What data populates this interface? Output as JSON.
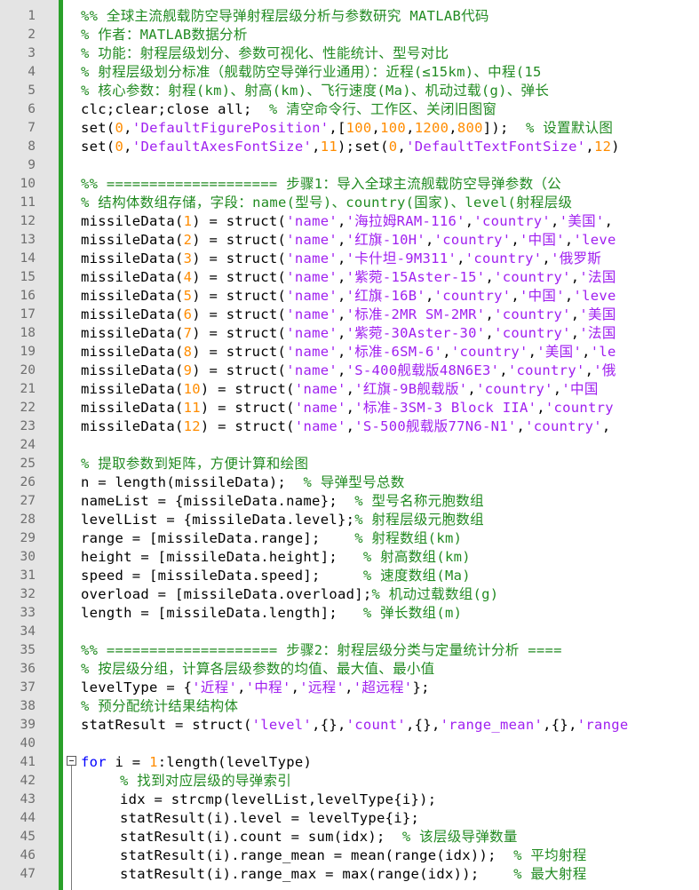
{
  "editor": {
    "colors": {
      "comment": "#228b22",
      "string": "#a020f0",
      "number": "#ff8c00",
      "keyword": "#0000ff",
      "gutter": "#e4e4e4",
      "fold_bar": "#2aa02a"
    },
    "lines": [
      {
        "n": "1",
        "tokens": [
          [
            "comment",
            "%% 全球主流舰载防空导弹射程层级分析与参数研究 MATLAB代码"
          ]
        ]
      },
      {
        "n": "2",
        "tokens": [
          [
            "comment",
            "% 作者：MATLAB数据分析"
          ]
        ]
      },
      {
        "n": "3",
        "tokens": [
          [
            "comment",
            "% 功能：射程层级划分、参数可视化、性能统计、型号对比"
          ]
        ]
      },
      {
        "n": "4",
        "tokens": [
          [
            "comment",
            "% 射程层级划分标准（舰载防空导弹行业通用）：近程(≤15km)、中程(15"
          ]
        ]
      },
      {
        "n": "5",
        "tokens": [
          [
            "comment",
            "% 核心参数：射程(km)、射高(km)、飞行速度(Ma)、机动过载(g)、弹长"
          ]
        ]
      },
      {
        "n": "6",
        "tokens": [
          [
            "text",
            "clc;clear;close all;  "
          ],
          [
            "comment",
            "% 清空命令行、工作区、关闭旧图窗"
          ]
        ]
      },
      {
        "n": "7",
        "tokens": [
          [
            "text",
            "set("
          ],
          [
            "number",
            "0"
          ],
          [
            "text",
            ","
          ],
          [
            "string",
            "'DefaultFigurePosition'"
          ],
          [
            "text",
            ",["
          ],
          [
            "number",
            "100"
          ],
          [
            "text",
            ","
          ],
          [
            "number",
            "100"
          ],
          [
            "text",
            ","
          ],
          [
            "number",
            "1200"
          ],
          [
            "text",
            ","
          ],
          [
            "number",
            "800"
          ],
          [
            "text",
            "]);  "
          ],
          [
            "comment",
            "% 设置默认图"
          ]
        ]
      },
      {
        "n": "8",
        "tokens": [
          [
            "text",
            "set("
          ],
          [
            "number",
            "0"
          ],
          [
            "text",
            ","
          ],
          [
            "string",
            "'DefaultAxesFontSize'"
          ],
          [
            "text",
            ","
          ],
          [
            "number",
            "11"
          ],
          [
            "text",
            ");set("
          ],
          [
            "number",
            "0"
          ],
          [
            "text",
            ","
          ],
          [
            "string",
            "'DefaultTextFontSize'"
          ],
          [
            "text",
            ","
          ],
          [
            "number",
            "12"
          ],
          [
            "text",
            ")"
          ]
        ]
      },
      {
        "n": "9",
        "tokens": []
      },
      {
        "n": "10",
        "tokens": [
          [
            "comment",
            "%% ==================== 步骤1：导入全球主流舰载防空导弹参数（公"
          ]
        ]
      },
      {
        "n": "11",
        "tokens": [
          [
            "comment",
            "% 结构体数组存储，字段：name(型号)、country(国家)、level(射程层级"
          ]
        ]
      },
      {
        "n": "12",
        "tokens": [
          [
            "text",
            "missileData("
          ],
          [
            "number",
            "1"
          ],
          [
            "text",
            ") = struct("
          ],
          [
            "string",
            "'name'"
          ],
          [
            "text",
            ","
          ],
          [
            "string",
            "'海拉姆RAM-116'"
          ],
          [
            "text",
            ","
          ],
          [
            "string",
            "'country'"
          ],
          [
            "text",
            ","
          ],
          [
            "string",
            "'美国'"
          ],
          [
            "text",
            ","
          ]
        ]
      },
      {
        "n": "13",
        "tokens": [
          [
            "text",
            "missileData("
          ],
          [
            "number",
            "2"
          ],
          [
            "text",
            ") = struct("
          ],
          [
            "string",
            "'name'"
          ],
          [
            "text",
            ","
          ],
          [
            "string",
            "'红旗-10H'"
          ],
          [
            "text",
            ","
          ],
          [
            "string",
            "'country'"
          ],
          [
            "text",
            ","
          ],
          [
            "string",
            "'中国'"
          ],
          [
            "text",
            ","
          ],
          [
            "string",
            "'leve"
          ]
        ]
      },
      {
        "n": "14",
        "tokens": [
          [
            "text",
            "missileData("
          ],
          [
            "number",
            "3"
          ],
          [
            "text",
            ") = struct("
          ],
          [
            "string",
            "'name'"
          ],
          [
            "text",
            ","
          ],
          [
            "string",
            "'卡什坦-9M311'"
          ],
          [
            "text",
            ","
          ],
          [
            "string",
            "'country'"
          ],
          [
            "text",
            ","
          ],
          [
            "string",
            "'俄罗斯"
          ]
        ]
      },
      {
        "n": "15",
        "tokens": [
          [
            "text",
            "missileData("
          ],
          [
            "number",
            "4"
          ],
          [
            "text",
            ") = struct("
          ],
          [
            "string",
            "'name'"
          ],
          [
            "text",
            ","
          ],
          [
            "string",
            "'紫菀-15Aster-15'"
          ],
          [
            "text",
            ","
          ],
          [
            "string",
            "'country'"
          ],
          [
            "text",
            ","
          ],
          [
            "string",
            "'法国"
          ]
        ]
      },
      {
        "n": "16",
        "tokens": [
          [
            "text",
            "missileData("
          ],
          [
            "number",
            "5"
          ],
          [
            "text",
            ") = struct("
          ],
          [
            "string",
            "'name'"
          ],
          [
            "text",
            ","
          ],
          [
            "string",
            "'红旗-16B'"
          ],
          [
            "text",
            ","
          ],
          [
            "string",
            "'country'"
          ],
          [
            "text",
            ","
          ],
          [
            "string",
            "'中国'"
          ],
          [
            "text",
            ","
          ],
          [
            "string",
            "'leve"
          ]
        ]
      },
      {
        "n": "17",
        "tokens": [
          [
            "text",
            "missileData("
          ],
          [
            "number",
            "6"
          ],
          [
            "text",
            ") = struct("
          ],
          [
            "string",
            "'name'"
          ],
          [
            "text",
            ","
          ],
          [
            "string",
            "'标准-2MR SM-2MR'"
          ],
          [
            "text",
            ","
          ],
          [
            "string",
            "'country'"
          ],
          [
            "text",
            ","
          ],
          [
            "string",
            "'美国"
          ]
        ]
      },
      {
        "n": "18",
        "tokens": [
          [
            "text",
            "missileData("
          ],
          [
            "number",
            "7"
          ],
          [
            "text",
            ") = struct("
          ],
          [
            "string",
            "'name'"
          ],
          [
            "text",
            ","
          ],
          [
            "string",
            "'紫菀-30Aster-30'"
          ],
          [
            "text",
            ","
          ],
          [
            "string",
            "'country'"
          ],
          [
            "text",
            ","
          ],
          [
            "string",
            "'法国"
          ]
        ]
      },
      {
        "n": "19",
        "tokens": [
          [
            "text",
            "missileData("
          ],
          [
            "number",
            "8"
          ],
          [
            "text",
            ") = struct("
          ],
          [
            "string",
            "'name'"
          ],
          [
            "text",
            ","
          ],
          [
            "string",
            "'标准-6SM-6'"
          ],
          [
            "text",
            ","
          ],
          [
            "string",
            "'country'"
          ],
          [
            "text",
            ","
          ],
          [
            "string",
            "'美国'"
          ],
          [
            "text",
            ","
          ],
          [
            "string",
            "'le"
          ]
        ]
      },
      {
        "n": "20",
        "tokens": [
          [
            "text",
            "missileData("
          ],
          [
            "number",
            "9"
          ],
          [
            "text",
            ") = struct("
          ],
          [
            "string",
            "'name'"
          ],
          [
            "text",
            ","
          ],
          [
            "string",
            "'S-400舰载版48N6E3'"
          ],
          [
            "text",
            ","
          ],
          [
            "string",
            "'country'"
          ],
          [
            "text",
            ","
          ],
          [
            "string",
            "'俄"
          ]
        ]
      },
      {
        "n": "21",
        "tokens": [
          [
            "text",
            "missileData("
          ],
          [
            "number",
            "10"
          ],
          [
            "text",
            ") = struct("
          ],
          [
            "string",
            "'name'"
          ],
          [
            "text",
            ","
          ],
          [
            "string",
            "'红旗-9B舰载版'"
          ],
          [
            "text",
            ","
          ],
          [
            "string",
            "'country'"
          ],
          [
            "text",
            ","
          ],
          [
            "string",
            "'中国"
          ]
        ]
      },
      {
        "n": "22",
        "tokens": [
          [
            "text",
            "missileData("
          ],
          [
            "number",
            "11"
          ],
          [
            "text",
            ") = struct("
          ],
          [
            "string",
            "'name'"
          ],
          [
            "text",
            ","
          ],
          [
            "string",
            "'标准-3SM-3 Block IIA'"
          ],
          [
            "text",
            ","
          ],
          [
            "string",
            "'country"
          ]
        ]
      },
      {
        "n": "23",
        "tokens": [
          [
            "text",
            "missileData("
          ],
          [
            "number",
            "12"
          ],
          [
            "text",
            ") = struct("
          ],
          [
            "string",
            "'name'"
          ],
          [
            "text",
            ","
          ],
          [
            "string",
            "'S-500舰载版77N6-N1'"
          ],
          [
            "text",
            ","
          ],
          [
            "string",
            "'country'"
          ],
          [
            "text",
            ","
          ]
        ]
      },
      {
        "n": "24",
        "tokens": []
      },
      {
        "n": "25",
        "tokens": [
          [
            "comment",
            "% 提取参数到矩阵，方便计算和绘图"
          ]
        ]
      },
      {
        "n": "26",
        "tokens": [
          [
            "text",
            "n = length(missileData);  "
          ],
          [
            "comment",
            "% 导弹型号总数"
          ]
        ]
      },
      {
        "n": "27",
        "tokens": [
          [
            "text",
            "nameList = {missileData.name};  "
          ],
          [
            "comment",
            "% 型号名称元胞数组"
          ]
        ]
      },
      {
        "n": "28",
        "tokens": [
          [
            "text",
            "levelList = {missileData.level};"
          ],
          [
            "comment",
            "% 射程层级元胞数组"
          ]
        ]
      },
      {
        "n": "29",
        "tokens": [
          [
            "text",
            "range = [missileData.range];    "
          ],
          [
            "comment",
            "% 射程数组(km)"
          ]
        ]
      },
      {
        "n": "30",
        "tokens": [
          [
            "text",
            "height = [missileData.height];   "
          ],
          [
            "comment",
            "% 射高数组(km)"
          ]
        ]
      },
      {
        "n": "31",
        "tokens": [
          [
            "text",
            "speed = [missileData.speed];     "
          ],
          [
            "comment",
            "% 速度数组(Ma)"
          ]
        ]
      },
      {
        "n": "32",
        "tokens": [
          [
            "text",
            "overload = [missileData.overload];"
          ],
          [
            "comment",
            "% 机动过载数组(g)"
          ]
        ]
      },
      {
        "n": "33",
        "tokens": [
          [
            "text",
            "length = [missileData.length];   "
          ],
          [
            "comment",
            "% 弹长数组(m)"
          ]
        ]
      },
      {
        "n": "34",
        "tokens": []
      },
      {
        "n": "35",
        "tokens": [
          [
            "comment",
            "%% ==================== 步骤2：射程层级分类与定量统计分析 ===="
          ]
        ]
      },
      {
        "n": "36",
        "tokens": [
          [
            "comment",
            "% 按层级分组，计算各层级参数的均值、最大值、最小值"
          ]
        ]
      },
      {
        "n": "37",
        "tokens": [
          [
            "text",
            "levelType = {"
          ],
          [
            "string",
            "'近程'"
          ],
          [
            "text",
            ","
          ],
          [
            "string",
            "'中程'"
          ],
          [
            "text",
            ","
          ],
          [
            "string",
            "'远程'"
          ],
          [
            "text",
            ","
          ],
          [
            "string",
            "'超远程'"
          ],
          [
            "text",
            "};"
          ]
        ]
      },
      {
        "n": "38",
        "tokens": [
          [
            "comment",
            "% 预分配统计结果结构体"
          ]
        ]
      },
      {
        "n": "39",
        "tokens": [
          [
            "text",
            "statResult = struct("
          ],
          [
            "string",
            "'level'"
          ],
          [
            "text",
            ",{},"
          ],
          [
            "string",
            "'count'"
          ],
          [
            "text",
            ",{},"
          ],
          [
            "string",
            "'range_mean'"
          ],
          [
            "text",
            ",{},"
          ],
          [
            "string",
            "'range"
          ]
        ]
      },
      {
        "n": "40",
        "tokens": []
      },
      {
        "n": "41",
        "tokens": [
          [
            "keyword",
            "for"
          ],
          [
            "text",
            " i = "
          ],
          [
            "number",
            "1"
          ],
          [
            "text",
            ":length(levelType)"
          ]
        ]
      },
      {
        "n": "42",
        "indent": true,
        "tokens": [
          [
            "comment",
            "% 找到对应层级的导弹索引"
          ]
        ]
      },
      {
        "n": "43",
        "indent": true,
        "tokens": [
          [
            "text",
            "idx = strcmp(levelList,levelType{i});"
          ]
        ]
      },
      {
        "n": "44",
        "indent": true,
        "tokens": [
          [
            "text",
            "statResult(i).level = levelType{i};"
          ]
        ]
      },
      {
        "n": "45",
        "indent": true,
        "tokens": [
          [
            "text",
            "statResult(i).count = sum(idx);  "
          ],
          [
            "comment",
            "% 该层级导弹数量"
          ]
        ]
      },
      {
        "n": "46",
        "indent": true,
        "tokens": [
          [
            "text",
            "statResult(i).range_mean = mean(range(idx));  "
          ],
          [
            "comment",
            "% 平均射程"
          ]
        ]
      },
      {
        "n": "47",
        "indent": true,
        "tokens": [
          [
            "text",
            "statResult(i).range_max = max(range(idx));    "
          ],
          [
            "comment",
            "% 最大射程"
          ]
        ]
      }
    ]
  }
}
